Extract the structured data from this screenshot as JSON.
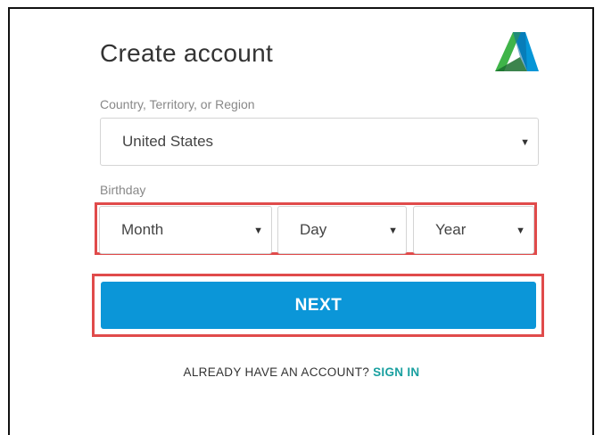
{
  "form": {
    "title": "Create account",
    "country_label": "Country, Territory, or Region",
    "country_value": "United States",
    "birthday_label": "Birthday",
    "month_value": "Month",
    "day_value": "Day",
    "year_value": "Year",
    "next_label": "NEXT",
    "already_text": "ALREADY HAVE AN ACCOUNT?",
    "signin_label": "SIGN IN"
  },
  "icons": {
    "logo": "autodesk-logo",
    "caret": "caret-down-icon"
  },
  "colors": {
    "primary_button": "#0b96d8",
    "link": "#1aa0a0",
    "highlight_border": "#e04b4b"
  }
}
